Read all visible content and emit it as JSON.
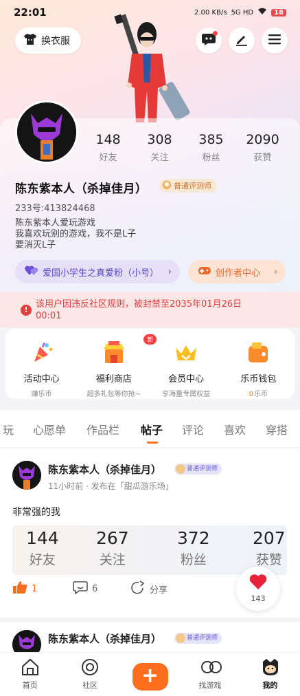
{
  "status_bar": {
    "time": "22:01",
    "net_speed": "2.00 KB/s",
    "network": "5G HD",
    "battery": "18"
  },
  "header": {
    "wardrobe_label": "换衣服"
  },
  "profile": {
    "stats": [
      {
        "value": "148",
        "label": "好友"
      },
      {
        "value": "308",
        "label": "关注"
      },
      {
        "value": "385",
        "label": "粉丝"
      },
      {
        "value": "2090",
        "label": "获赞"
      }
    ],
    "name": "陈东紫本人（杀掉佳月）",
    "badge": "普通评测师",
    "uid": "233号:413824468",
    "bio": [
      "陈东紫本人爱玩游戏",
      "我喜欢玩别的游戏，我不是L子",
      "要消灭L子"
    ],
    "fan_pill": "爱国小学生之真爱粉（小号）",
    "creator_pill": "创作者中心"
  },
  "ban_notice": {
    "line1": "该用户因违反社区规则，被封禁至2035年01月26日",
    "line2": "00:01"
  },
  "quick_links": [
    {
      "title": "活动中心",
      "sub": "赚乐币",
      "icon": "party-popper-icon"
    },
    {
      "title": "福利商店",
      "sub": "超多礼包等你抢~",
      "icon": "shop-icon",
      "tag": "新"
    },
    {
      "title": "会员中心",
      "sub": "享海量专属权益",
      "icon": "crown-icon"
    },
    {
      "title": "乐币钱包",
      "sub_value": "0",
      "sub": "乐币",
      "icon": "wallet-icon"
    }
  ],
  "tabs": [
    "玩",
    "心愿单",
    "作品栏",
    "帖子",
    "评论",
    "喜欢",
    "穿搭"
  ],
  "active_tab": "帖子",
  "post": {
    "author": "陈东紫本人（杀掉佳月）",
    "badge": "普通评测师",
    "meta": "11小时前 · 发布在「甜瓜游乐场」",
    "text": "非常强的我",
    "stats": [
      {
        "value": "144",
        "label": "好友"
      },
      {
        "value": "267",
        "label": "关注"
      },
      {
        "value": "372",
        "label": "粉丝"
      },
      {
        "value": "207",
        "label": "获赞"
      }
    ],
    "likes": "1",
    "comments": "6",
    "share_label": "分享"
  },
  "heart_count": "143",
  "post2": {
    "author": "陈东紫本人（杀掉佳月）",
    "badge": "普通评测师"
  },
  "bottom_nav": [
    {
      "label": "首页",
      "icon": "home-icon"
    },
    {
      "label": "社区",
      "icon": "community-icon"
    },
    {
      "label": "",
      "icon": "plus-icon"
    },
    {
      "label": "找游戏",
      "icon": "find-game-icon"
    },
    {
      "label": "我的",
      "icon": "me-icon"
    }
  ],
  "colors": {
    "accent": "#ff6d1f",
    "ban_red": "#e23d3d",
    "fan_purple": "#5b47c9"
  }
}
